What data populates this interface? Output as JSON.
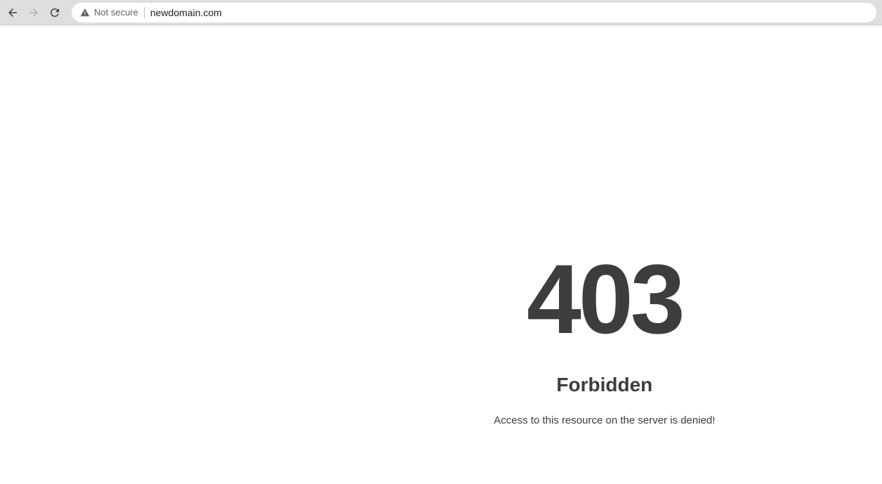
{
  "browser": {
    "security_label": "Not secure",
    "url": "newdomain.com"
  },
  "error": {
    "code": "403",
    "title": "Forbidden",
    "message": "Access to this resource on the server is denied!"
  }
}
